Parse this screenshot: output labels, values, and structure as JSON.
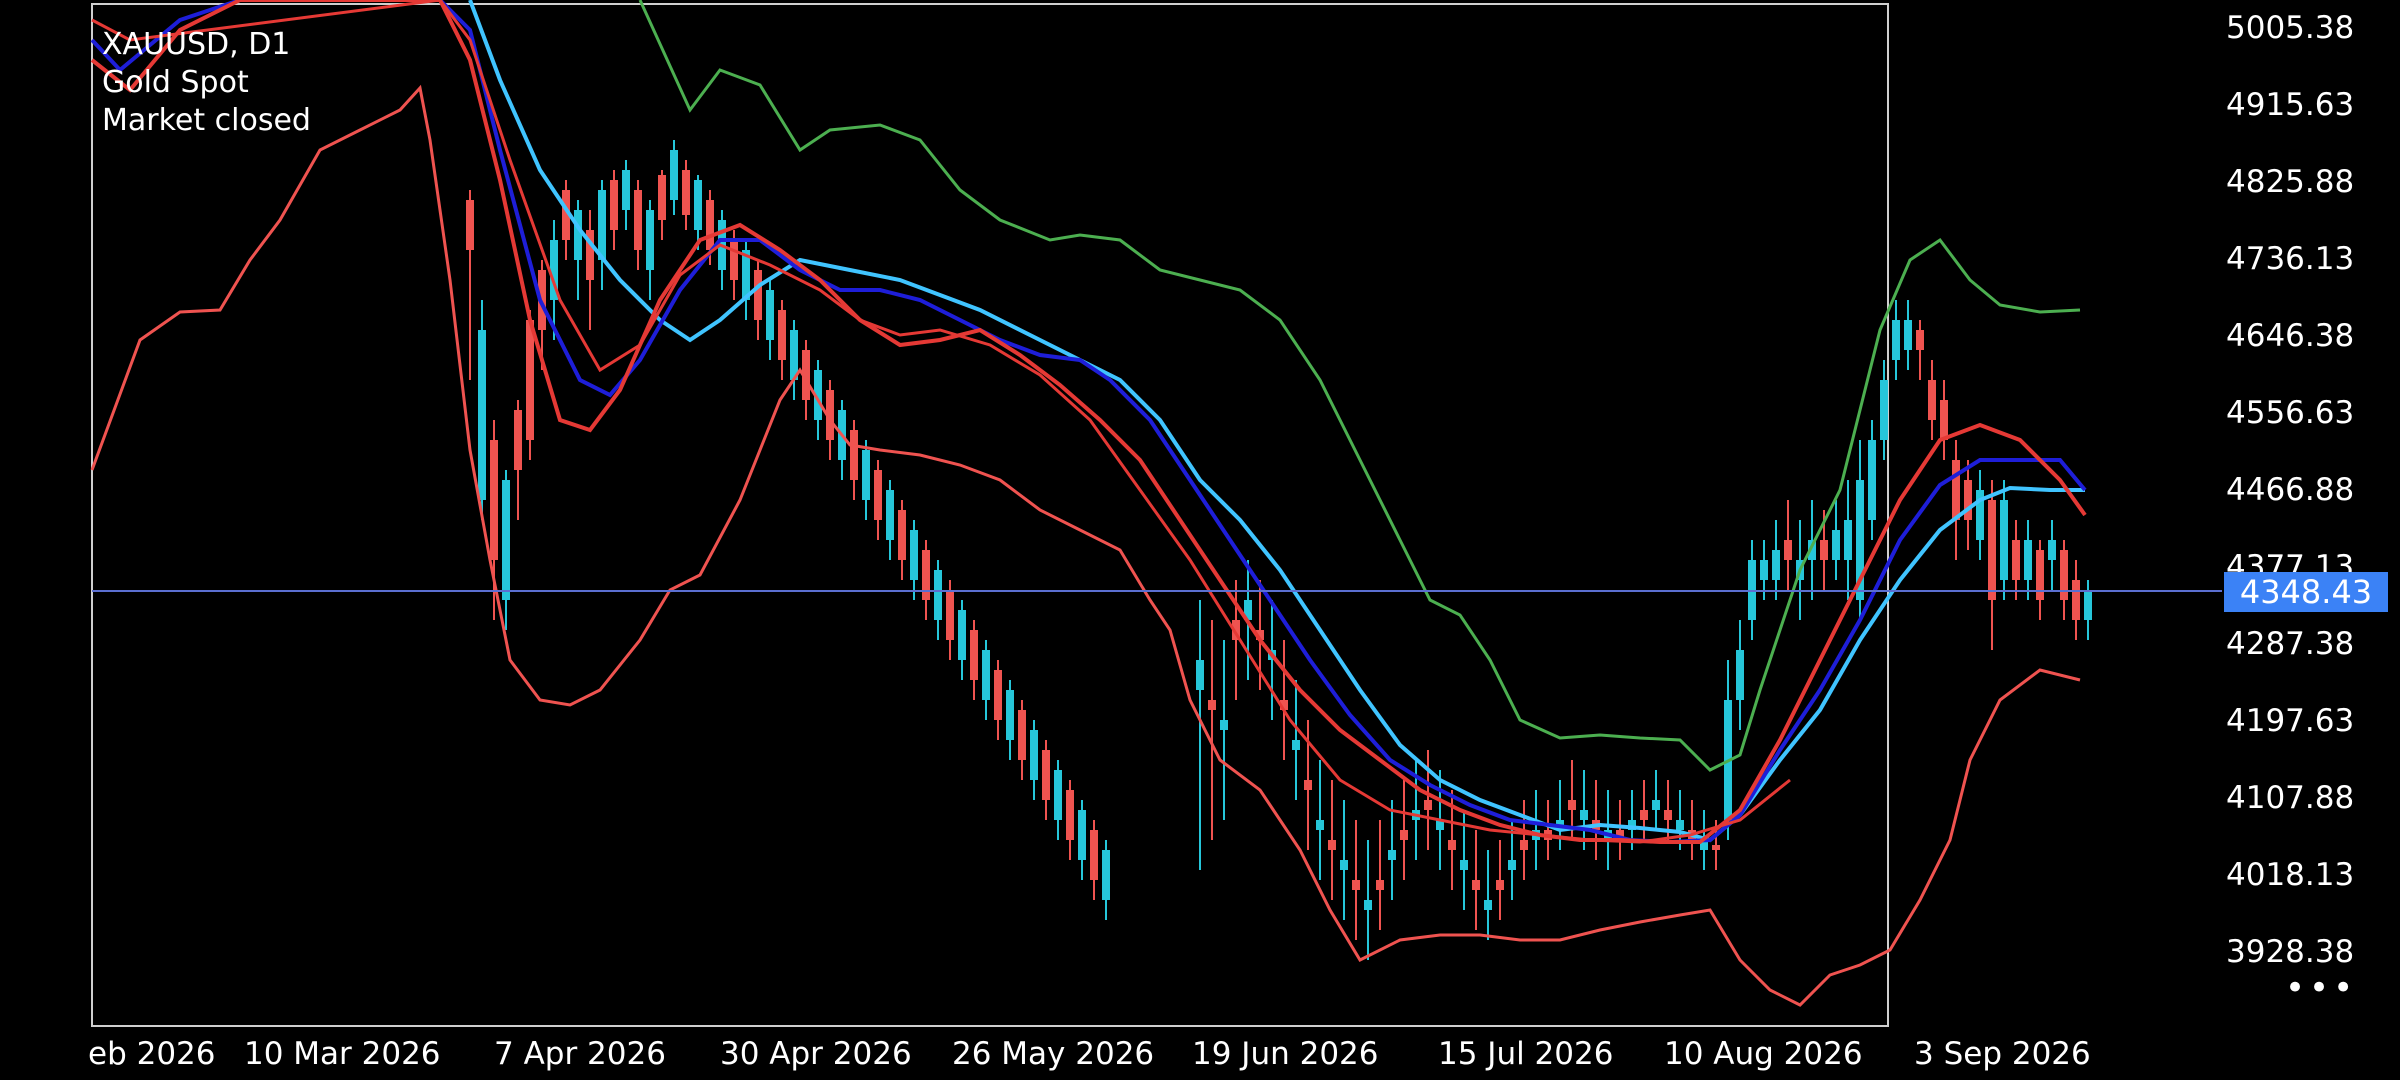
{
  "symbol": {
    "title": "XAUUSD, D1",
    "name": "Gold Spot",
    "status": "Market closed"
  },
  "price_scale": [
    "5005.38",
    "4915.63",
    "4825.88",
    "4736.13",
    "4646.38",
    "4556.63",
    "4466.88",
    "4377.13",
    "4287.38",
    "4197.63",
    "4107.88",
    "4018.13",
    "3928.38"
  ],
  "date_axis": [
    "eb 2026",
    "10 Mar 2026",
    "7 Apr 2026",
    "30 Apr 2026",
    "26 May 2026",
    "19 Jun 2026",
    "15 Jul 2026",
    "10 Aug 2026",
    "3 Sep 2026"
  ],
  "current_price": "4348.43",
  "colors": {
    "bull": "#26c6da",
    "bear": "#ef5350",
    "bb_upper": "#4caf50",
    "bb_lower": "#ef5350",
    "ma_fast": "#e53935",
    "ma_mid": "#1e1ed8",
    "ma_slow": "#40c4ff",
    "price_line": "#5b6fd1",
    "price_tag": "#3b82f6"
  },
  "icons": {
    "menu": "more-dots-icon"
  }
}
